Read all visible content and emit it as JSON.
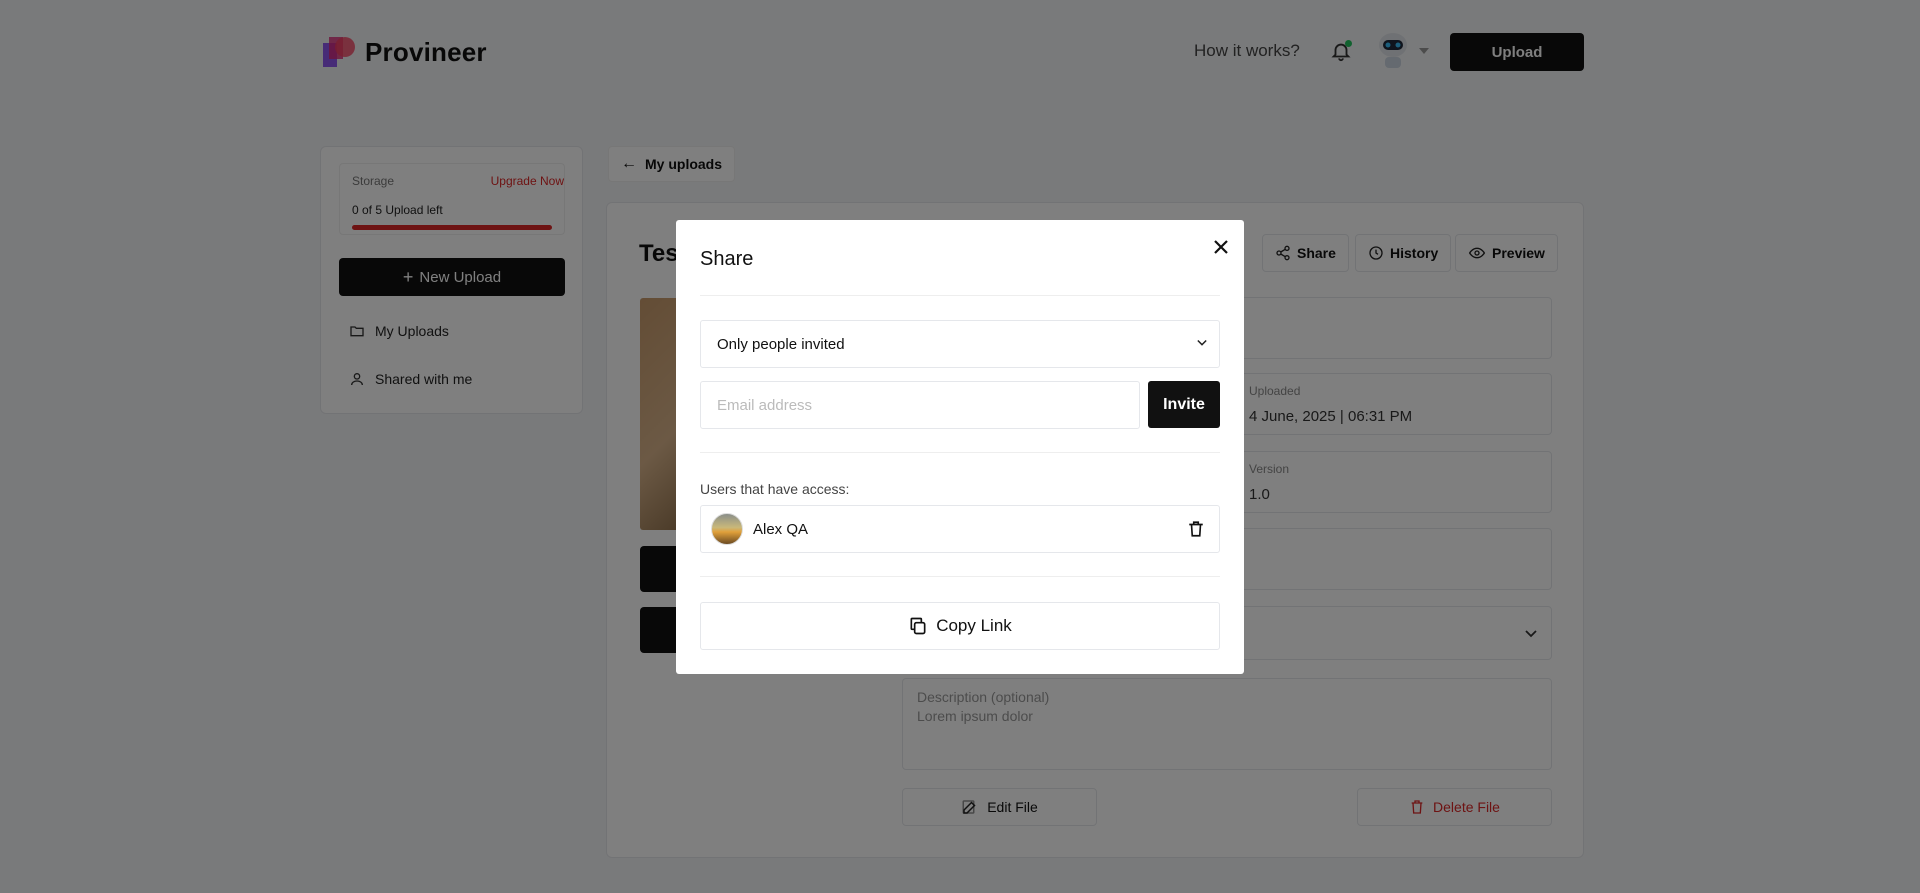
{
  "header": {
    "logo_text": "Provineer",
    "how_it_works": "How it works?",
    "upload_label": "Upload"
  },
  "sidebar": {
    "storage_label": "Storage",
    "upgrade_label": "Upgrade Now",
    "uploads_left": "0 of 5 Upload left",
    "storage_used_fraction": 1.0,
    "new_upload_label": "New Upload",
    "items": [
      {
        "label": "My Uploads",
        "icon": "folder-icon"
      },
      {
        "label": "Shared with me",
        "icon": "user-icon"
      }
    ]
  },
  "main": {
    "back_label": "My uploads",
    "title_partial": "Tes",
    "actions": [
      {
        "label": "Share",
        "icon": "share-icon"
      },
      {
        "label": "History",
        "icon": "clock-icon"
      },
      {
        "label": "Preview",
        "icon": "eye-icon"
      }
    ],
    "uploaded_label": "Uploaded",
    "uploaded_value": "4 June, 2025 | 06:31 PM",
    "version_label": "Version",
    "version_value": "1.0",
    "description_placeholder": "Description (optional)",
    "description_value": "Lorem ipsum dolor",
    "edit_label": "Edit File",
    "delete_label": "Delete File"
  },
  "modal": {
    "title": "Share",
    "access_option": "Only people invited",
    "email_placeholder": "Email address",
    "invite_label": "Invite",
    "users_label": "Users that have access:",
    "users": [
      {
        "name": "Alex QA"
      }
    ],
    "copy_link_label": "Copy Link"
  },
  "colors": {
    "accent_dark": "#111111",
    "danger": "#dc2626",
    "notification_dot": "#22c55e"
  }
}
